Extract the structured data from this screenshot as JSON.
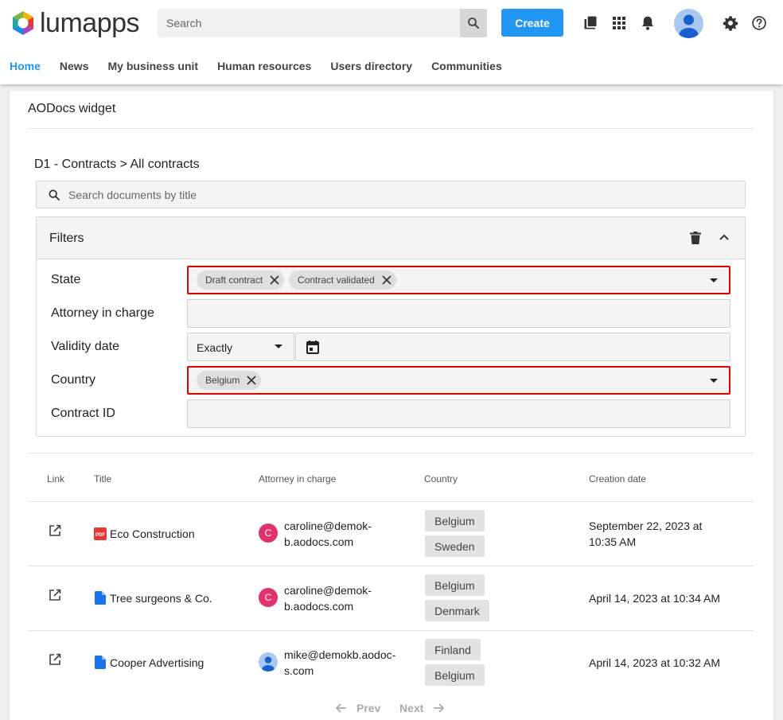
{
  "brand": {
    "name": "lumapps"
  },
  "search": {
    "placeholder": "Search"
  },
  "header": {
    "create_label": "Create"
  },
  "nav": {
    "items": [
      {
        "label": "Home",
        "active": true
      },
      {
        "label": "News"
      },
      {
        "label": "My business unit"
      },
      {
        "label": "Human resources"
      },
      {
        "label": "Users directory"
      },
      {
        "label": "Communities"
      }
    ]
  },
  "widget": {
    "title": "AODocs widget",
    "breadcrumb": "D1 - Contracts > All contracts",
    "doc_search_placeholder": "Search documents by title",
    "filters": {
      "title": "Filters",
      "state": {
        "label": "State",
        "chips": [
          "Draft contract",
          "Contract validated"
        ]
      },
      "attorney": {
        "label": "Attorney in charge",
        "value": ""
      },
      "validity": {
        "label": "Validity date",
        "mode": "Exactly"
      },
      "country": {
        "label": "Country",
        "chips": [
          "Belgium"
        ]
      },
      "contract_id": {
        "label": "Contract ID",
        "value": ""
      }
    }
  },
  "table": {
    "headers": [
      "Link",
      "Title",
      "Attorney in charge",
      "Country",
      "Creation date"
    ],
    "rows": [
      {
        "title": "Eco Construction",
        "file_type": "pdf",
        "attorney_line1": "caroline@demok-",
        "attorney_line2": "b.aodocs.com",
        "avatar_initial": "C",
        "countries": [
          "Belgium",
          "Sweden"
        ],
        "date_line1": "September 22, 2023 at",
        "date_line2": "10:35 AM"
      },
      {
        "title": "Tree surgeons & Co.",
        "file_type": "doc",
        "attorney_line1": "caroline@demok-",
        "attorney_line2": "b.aodocs.com",
        "avatar_initial": "C",
        "countries": [
          "Belgium",
          "Denmark"
        ],
        "date_line1": "April 14, 2023 at 10:34 AM"
      },
      {
        "title": "Cooper Advertising",
        "file_type": "doc",
        "attorney_line1": "mike@demokb.aodoc-",
        "attorney_line2": "s.com",
        "countries": [
          "Finland",
          "Belgium"
        ],
        "date_line1": "April 14, 2023 at 10:32 AM"
      }
    ]
  },
  "pagination": {
    "prev_label": "Prev",
    "next_label": "Next"
  },
  "colors": {
    "accent": "#2196f3",
    "highlight_border": "#e00000",
    "avatar_c": "#e0336a",
    "pdf_red": "#e53935",
    "doc_blue": "#1a73e8"
  },
  "icons": [
    "search-icon",
    "library-icon",
    "apps-grid-icon",
    "bell-icon",
    "user-avatar",
    "gear-icon",
    "help-icon",
    "trash-icon",
    "chevron-up-icon",
    "close-icon",
    "caret-down-icon",
    "calendar-icon",
    "open-in-new-icon",
    "pdf-file-icon",
    "doc-file-icon",
    "arrow-left-icon",
    "arrow-right-icon"
  ]
}
